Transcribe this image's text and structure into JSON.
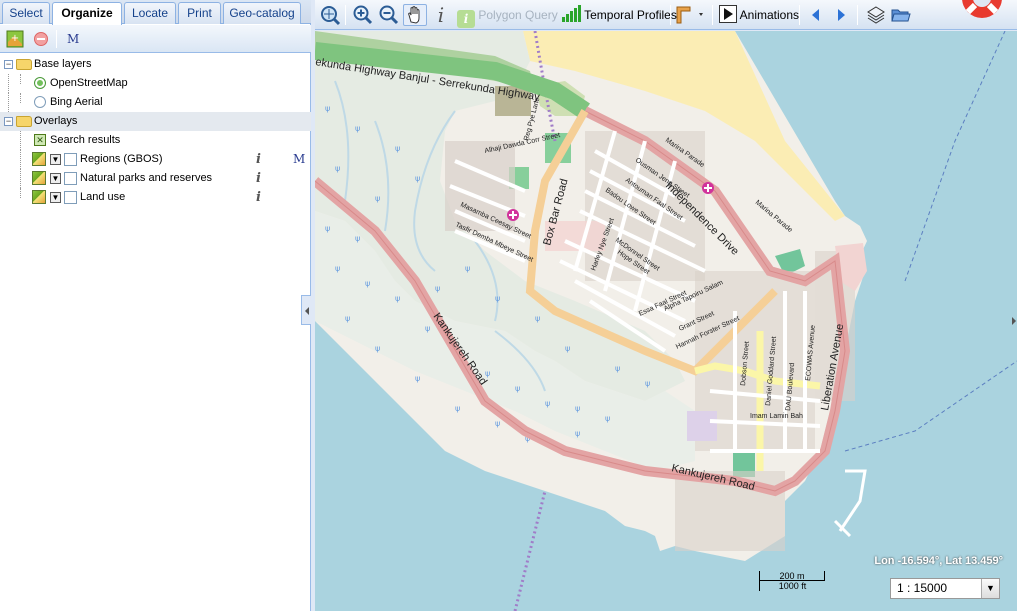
{
  "tabs": [
    {
      "label": "Select",
      "active": false
    },
    {
      "label": "Organize",
      "active": true
    },
    {
      "label": "Locate",
      "active": false
    },
    {
      "label": "Print",
      "active": false
    },
    {
      "label": "Geo-catalog",
      "active": false
    }
  ],
  "left_toolbar": {
    "add_layer_icon": "add-layer-icon",
    "remove_layer_icon": "remove-icon",
    "metadata_icon": "M"
  },
  "tree": {
    "base_layers_label": "Base layers",
    "osm_label": "OpenStreetMap",
    "bing_label": "Bing Aerial",
    "overlays_label": "Overlays",
    "search_results_label": "Search results",
    "regions_label": "Regions (GBOS)",
    "parks_label": "Natural parks and reserves",
    "landuse_label": "Land use",
    "info_glyph": "i",
    "metadata_glyph": "M"
  },
  "main_toolbar": {
    "polygon_query_label": "Polygon Query",
    "temporal_profiles_label": "Temporal Profiles",
    "animations_label": "Animations"
  },
  "map": {
    "coordinates": "Lon -16.594°, Lat 13.459°",
    "scale_metric": "200 m",
    "scale_imperial": "1000 ft",
    "scale_select_value": "1 : 15000",
    "labels": {
      "banjul_highway": "ekunda Highway Banjul - Serrekunda Highway",
      "independence_drive": "Independence Drive",
      "box_bar_road": "Box Bar Road",
      "kankujereh_road_1": "Kankujereh Road",
      "kankujereh_road_2": "Kankujereh Road",
      "liberation_avenue": "Liberation Avenue",
      "marina_parade_1": "Marina Parade",
      "marina_parade_2": "Marina Parade",
      "alhaji_street": "Alhaji Dawda Corr Street",
      "masamba_street": "Masamba Ceesay Street",
      "tasfir_street": "Tasfir Demba Mbeye Street",
      "ouisman_street": "Ousman Jeng Street",
      "antouman_street": "Antouman Faal Street",
      "badou_street": "Badou Lowe Street",
      "mcdonnel_street": "McDonnel Street",
      "hope_street": "Hope Street",
      "harley_street": "Harley Nye Street",
      "essa_street": "Essa Faal Street",
      "alpha_street": "Alpha Tapoiru Salam",
      "grant_street": "Grant Street",
      "hannah_street": "Hannah Forster Street",
      "dobson_street": "Dobson Street",
      "daniel_street": "Daniel Goddard Street",
      "dau_boulevard": "DAU Boulevard",
      "ecowas_avenue": "ECOWAS Avenue",
      "imam_street": "Imam Lamin Bah",
      "reg_pye_lane": "Reg Pye Lane"
    }
  }
}
